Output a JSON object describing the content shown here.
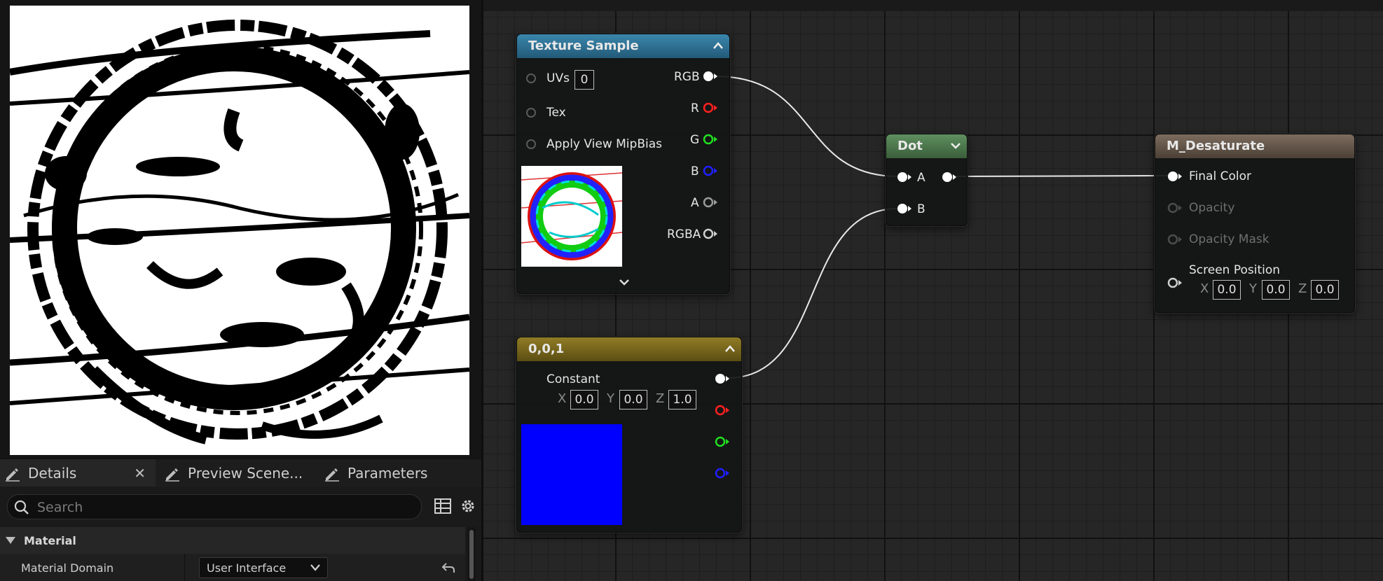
{
  "details_panel": {
    "tabs": [
      {
        "label": "Details",
        "active": true
      },
      {
        "label": "Preview Scene..."
      },
      {
        "label": "Parameters"
      }
    ],
    "search": {
      "placeholder": "Search"
    },
    "category": "Material",
    "property": {
      "label": "Material Domain",
      "value": "User Interface"
    }
  },
  "graph": {
    "nodes": {
      "texture_sample": {
        "title": "Texture Sample",
        "header_color": "#2b6f93",
        "inputs": {
          "uvs": "UVs",
          "uvs_value": "0",
          "tex": "Tex",
          "apply_mip": "Apply View MipBias"
        },
        "outputs": {
          "rgb": "RGB",
          "r": "R",
          "g": "G",
          "b": "B",
          "a": "A",
          "rgba": "RGBA"
        }
      },
      "constant": {
        "title": "0,0,1",
        "header_color": "#7d6a1c",
        "label": "Constant",
        "x_label": "X",
        "x": "0.0",
        "y_label": "Y",
        "y": "0.0",
        "z_label": "Z",
        "z": "1.0",
        "swatch_color": "#0000ff"
      },
      "dot": {
        "title": "Dot",
        "header_color": "#4d7a4d",
        "a": "A",
        "b": "B"
      },
      "result": {
        "title": "M_Desaturate",
        "header_color": "#6e5f52",
        "final_color": "Final Color",
        "opacity": "Opacity",
        "opacity_mask": "Opacity Mask",
        "screen_position": "Screen Position",
        "x_label": "X",
        "x": "0.0",
        "y_label": "Y",
        "y": "0.0",
        "z_label": "Z",
        "z": "0.0"
      }
    },
    "pin_colors": {
      "white": "#ffffff",
      "red": "#ff2020",
      "green": "#20e020",
      "blue": "#2020ff",
      "gray": "#9a9a9a"
    }
  }
}
